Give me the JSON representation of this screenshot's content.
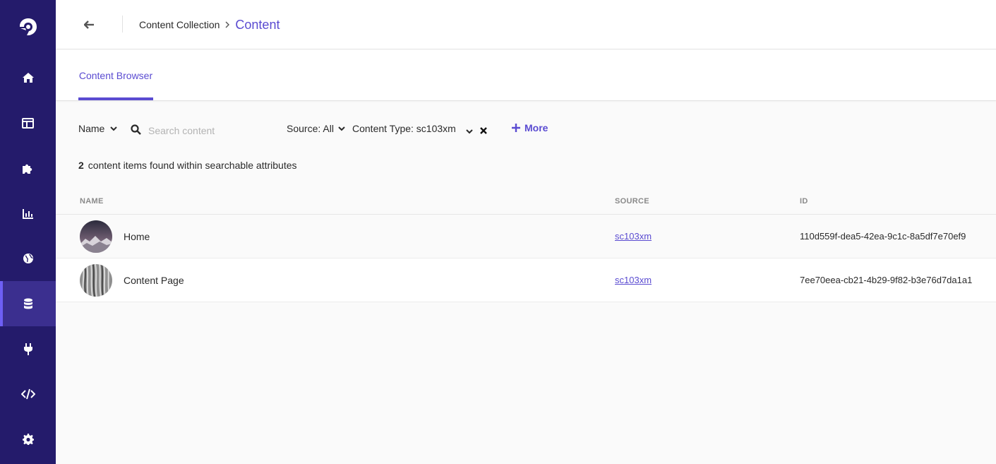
{
  "sidebar": {
    "items": [
      {
        "icon": "home-icon",
        "active": false
      },
      {
        "icon": "dashboard-icon",
        "active": false
      },
      {
        "icon": "puzzle-icon",
        "active": false
      },
      {
        "icon": "analytics-icon",
        "active": false
      },
      {
        "icon": "globe-icon",
        "active": false
      },
      {
        "icon": "database-icon",
        "active": true
      },
      {
        "icon": "plug-icon",
        "active": false
      },
      {
        "icon": "code-icon",
        "active": false
      },
      {
        "icon": "gear-icon",
        "active": false
      }
    ]
  },
  "header": {
    "breadcrumb_parent": "Content Collection",
    "breadcrumb_current": "Content"
  },
  "tabs": [
    {
      "label": "Content Browser",
      "active": true
    }
  ],
  "filters": {
    "name_select": "Name",
    "search_placeholder": "Search content",
    "source_select": "Source: All",
    "content_type_select": "Content Type: sc103xm",
    "more_label": "More"
  },
  "results": {
    "count": "2",
    "text": "content items found within searchable attributes"
  },
  "table": {
    "columns": [
      "NAME",
      "SOURCE",
      "ID"
    ],
    "rows": [
      {
        "name": "Home",
        "source": "sc103xm",
        "id": "110d559f-dea5-42ea-9c1c-8a5df7e70ef9"
      },
      {
        "name": "Content Page",
        "source": "sc103xm",
        "id": "7ee70eea-cb21-4b29-9f82-b3e76d7da1a1"
      }
    ]
  },
  "colors": {
    "sidebar": "#241b6b",
    "accent": "#5a4bd1",
    "sidebar_active": "#3b2f8f"
  }
}
